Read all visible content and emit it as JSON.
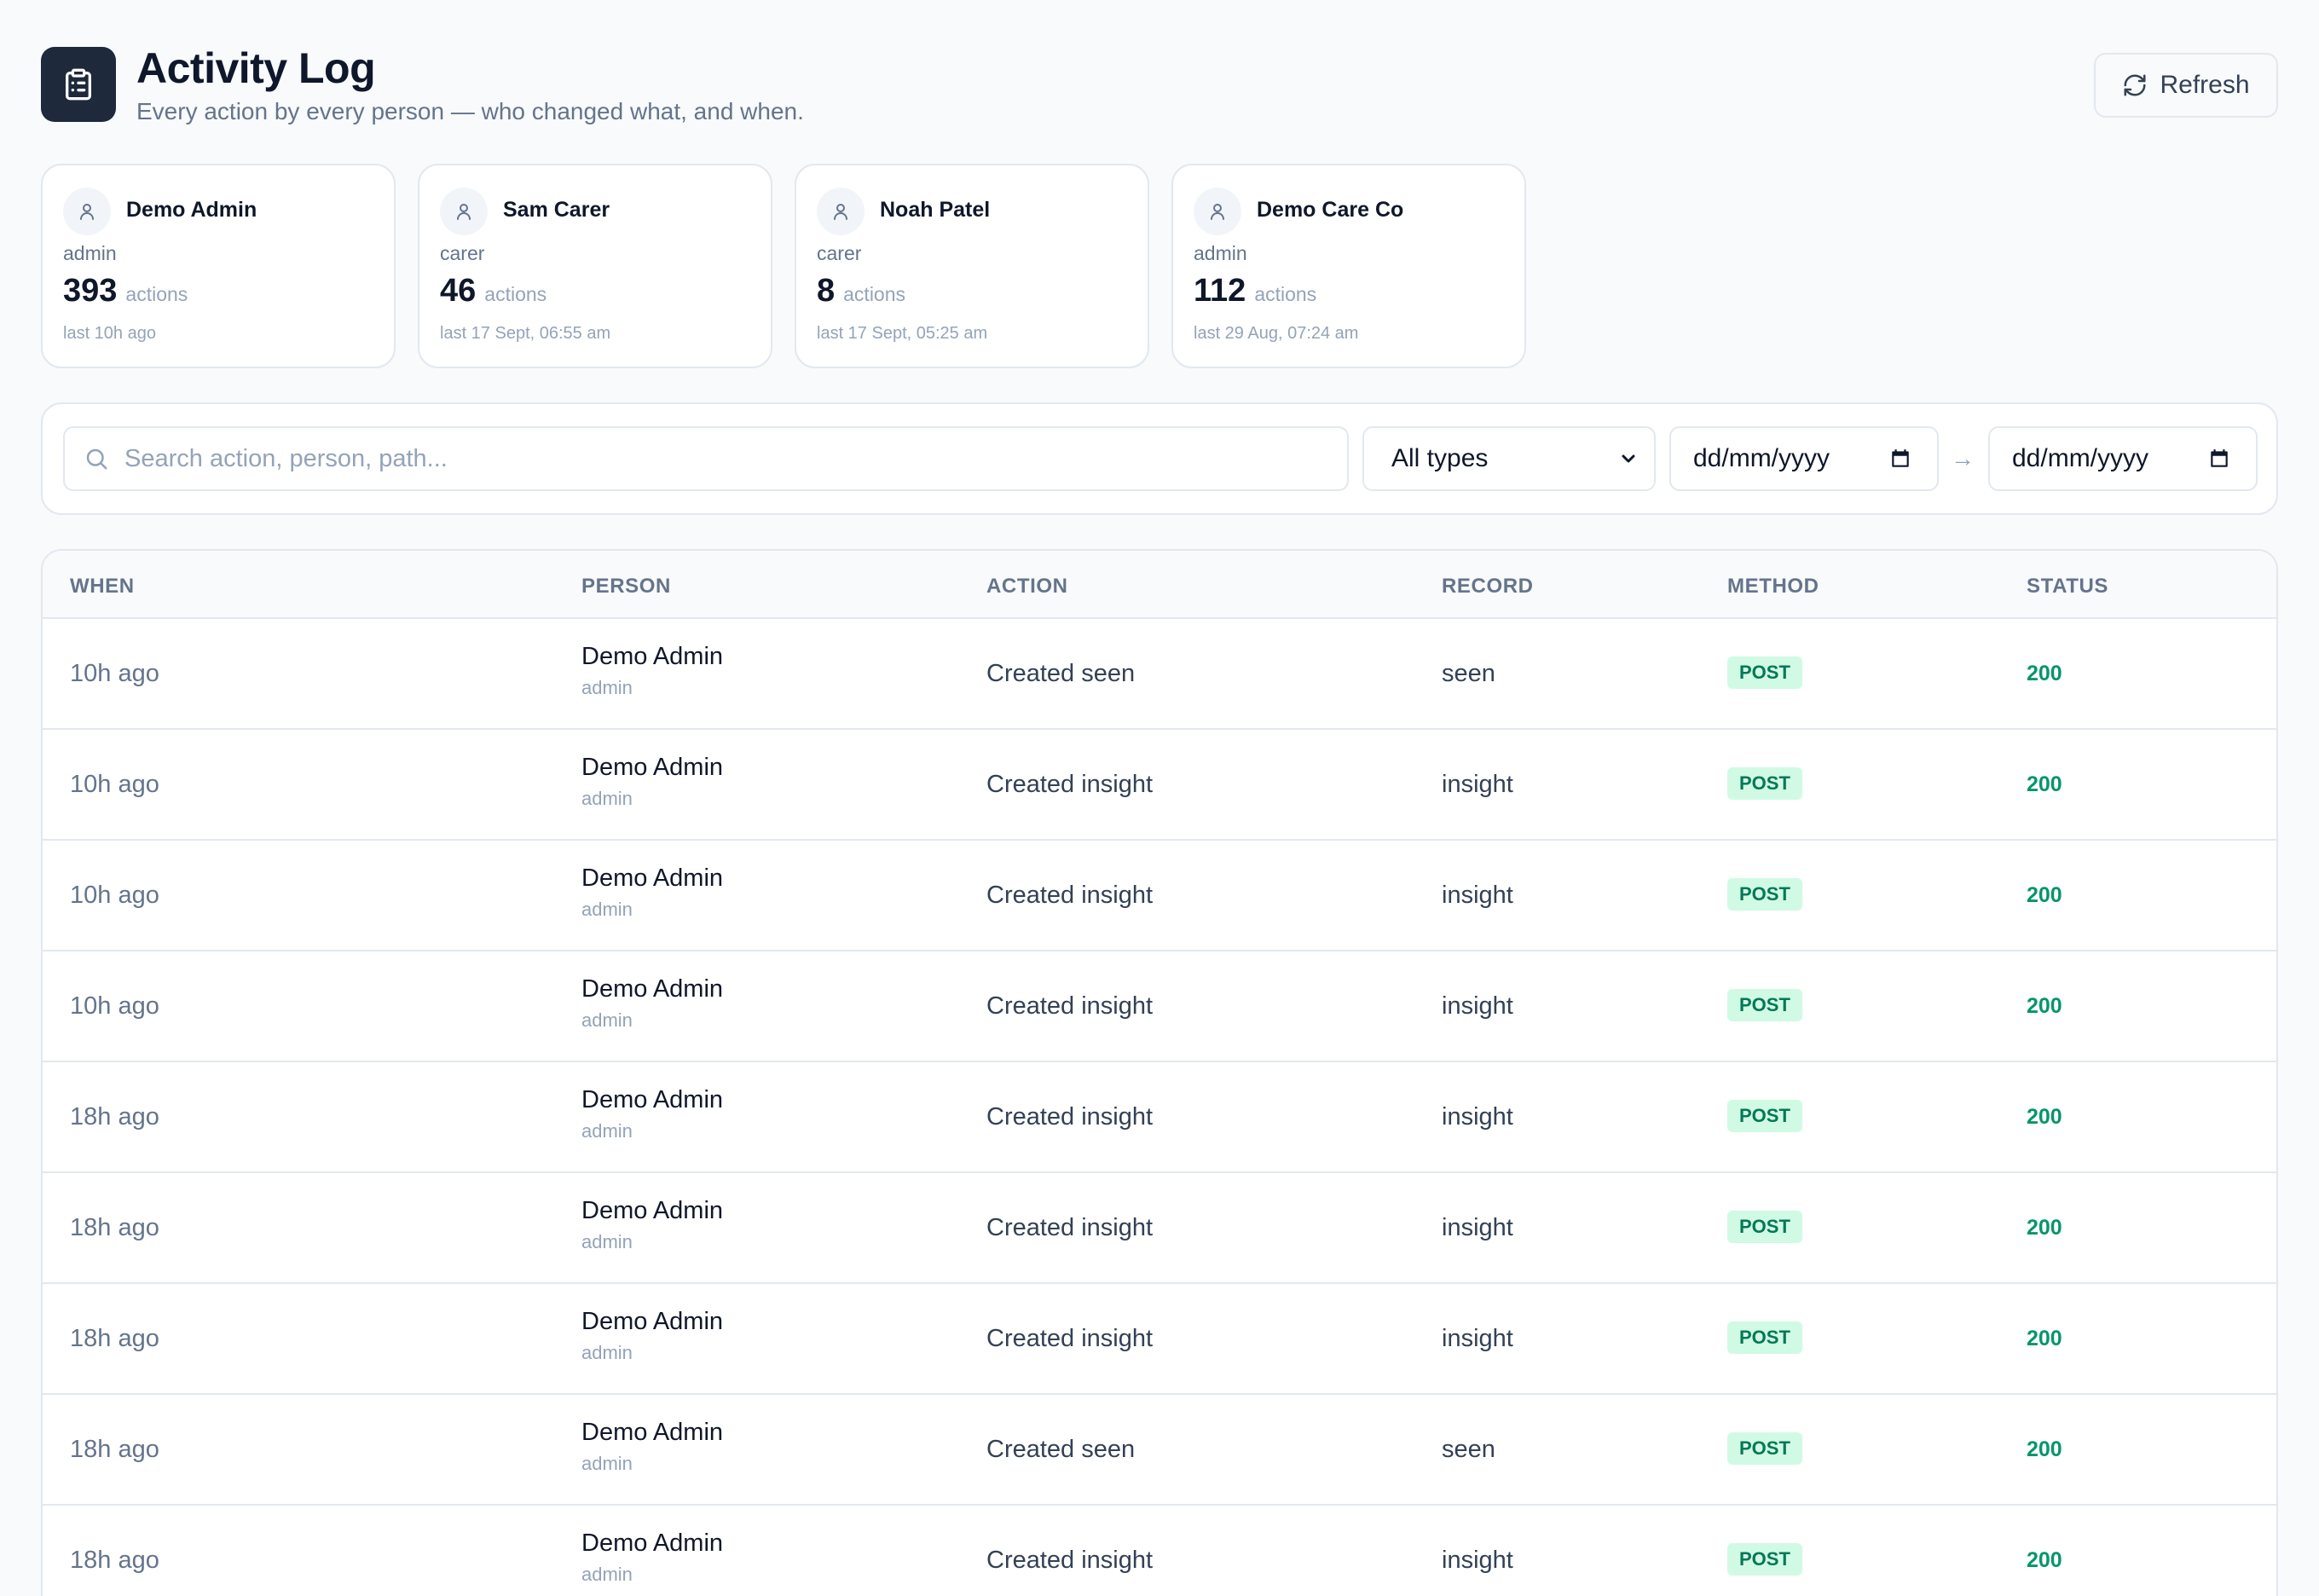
{
  "header": {
    "title": "Activity Log",
    "subtitle": "Every action by every person — who changed what, and when.",
    "refresh_label": "Refresh"
  },
  "people": [
    {
      "name": "Demo Admin",
      "role": "admin",
      "count": "393",
      "count_label": "actions",
      "last": "last 10h ago"
    },
    {
      "name": "Sam Carer",
      "role": "carer",
      "count": "46",
      "count_label": "actions",
      "last": "last 17 Sept, 06:55 am"
    },
    {
      "name": "Noah Patel",
      "role": "carer",
      "count": "8",
      "count_label": "actions",
      "last": "last 17 Sept, 05:25 am"
    },
    {
      "name": "Demo Care Co",
      "role": "admin",
      "count": "112",
      "count_label": "actions",
      "last": "last 29 Aug, 07:24 am"
    }
  ],
  "filters": {
    "search_placeholder": "Search action, person, path...",
    "type_selected": "All types",
    "date_from_placeholder": "dd/mm/yyyy",
    "date_to_placeholder": "dd/mm/yyyy",
    "range_separator": "→"
  },
  "table": {
    "columns": [
      "WHEN",
      "PERSON",
      "ACTION",
      "RECORD",
      "METHOD",
      "STATUS"
    ],
    "rows": [
      {
        "when": "10h ago",
        "person": "Demo Admin",
        "role": "admin",
        "action": "Created seen",
        "record": "seen",
        "method": "POST",
        "status": "200"
      },
      {
        "when": "10h ago",
        "person": "Demo Admin",
        "role": "admin",
        "action": "Created insight",
        "record": "insight",
        "method": "POST",
        "status": "200"
      },
      {
        "when": "10h ago",
        "person": "Demo Admin",
        "role": "admin",
        "action": "Created insight",
        "record": "insight",
        "method": "POST",
        "status": "200"
      },
      {
        "when": "10h ago",
        "person": "Demo Admin",
        "role": "admin",
        "action": "Created insight",
        "record": "insight",
        "method": "POST",
        "status": "200"
      },
      {
        "when": "18h ago",
        "person": "Demo Admin",
        "role": "admin",
        "action": "Created insight",
        "record": "insight",
        "method": "POST",
        "status": "200"
      },
      {
        "when": "18h ago",
        "person": "Demo Admin",
        "role": "admin",
        "action": "Created insight",
        "record": "insight",
        "method": "POST",
        "status": "200"
      },
      {
        "when": "18h ago",
        "person": "Demo Admin",
        "role": "admin",
        "action": "Created insight",
        "record": "insight",
        "method": "POST",
        "status": "200"
      },
      {
        "when": "18h ago",
        "person": "Demo Admin",
        "role": "admin",
        "action": "Created seen",
        "record": "seen",
        "method": "POST",
        "status": "200"
      },
      {
        "when": "18h ago",
        "person": "Demo Admin",
        "role": "admin",
        "action": "Created insight",
        "record": "insight",
        "method": "POST",
        "status": "200"
      }
    ]
  },
  "colors": {
    "accent_dark": "#1e293b",
    "method_badge_bg": "#d1fae5",
    "method_badge_text": "#047857",
    "status_success": "#059669"
  },
  "icons": {
    "header": "clipboard-list-icon",
    "refresh": "refresh-icon",
    "avatar": "user-icon",
    "search": "search-icon",
    "select": "chevron-down-icon",
    "date": "calendar-icon"
  }
}
